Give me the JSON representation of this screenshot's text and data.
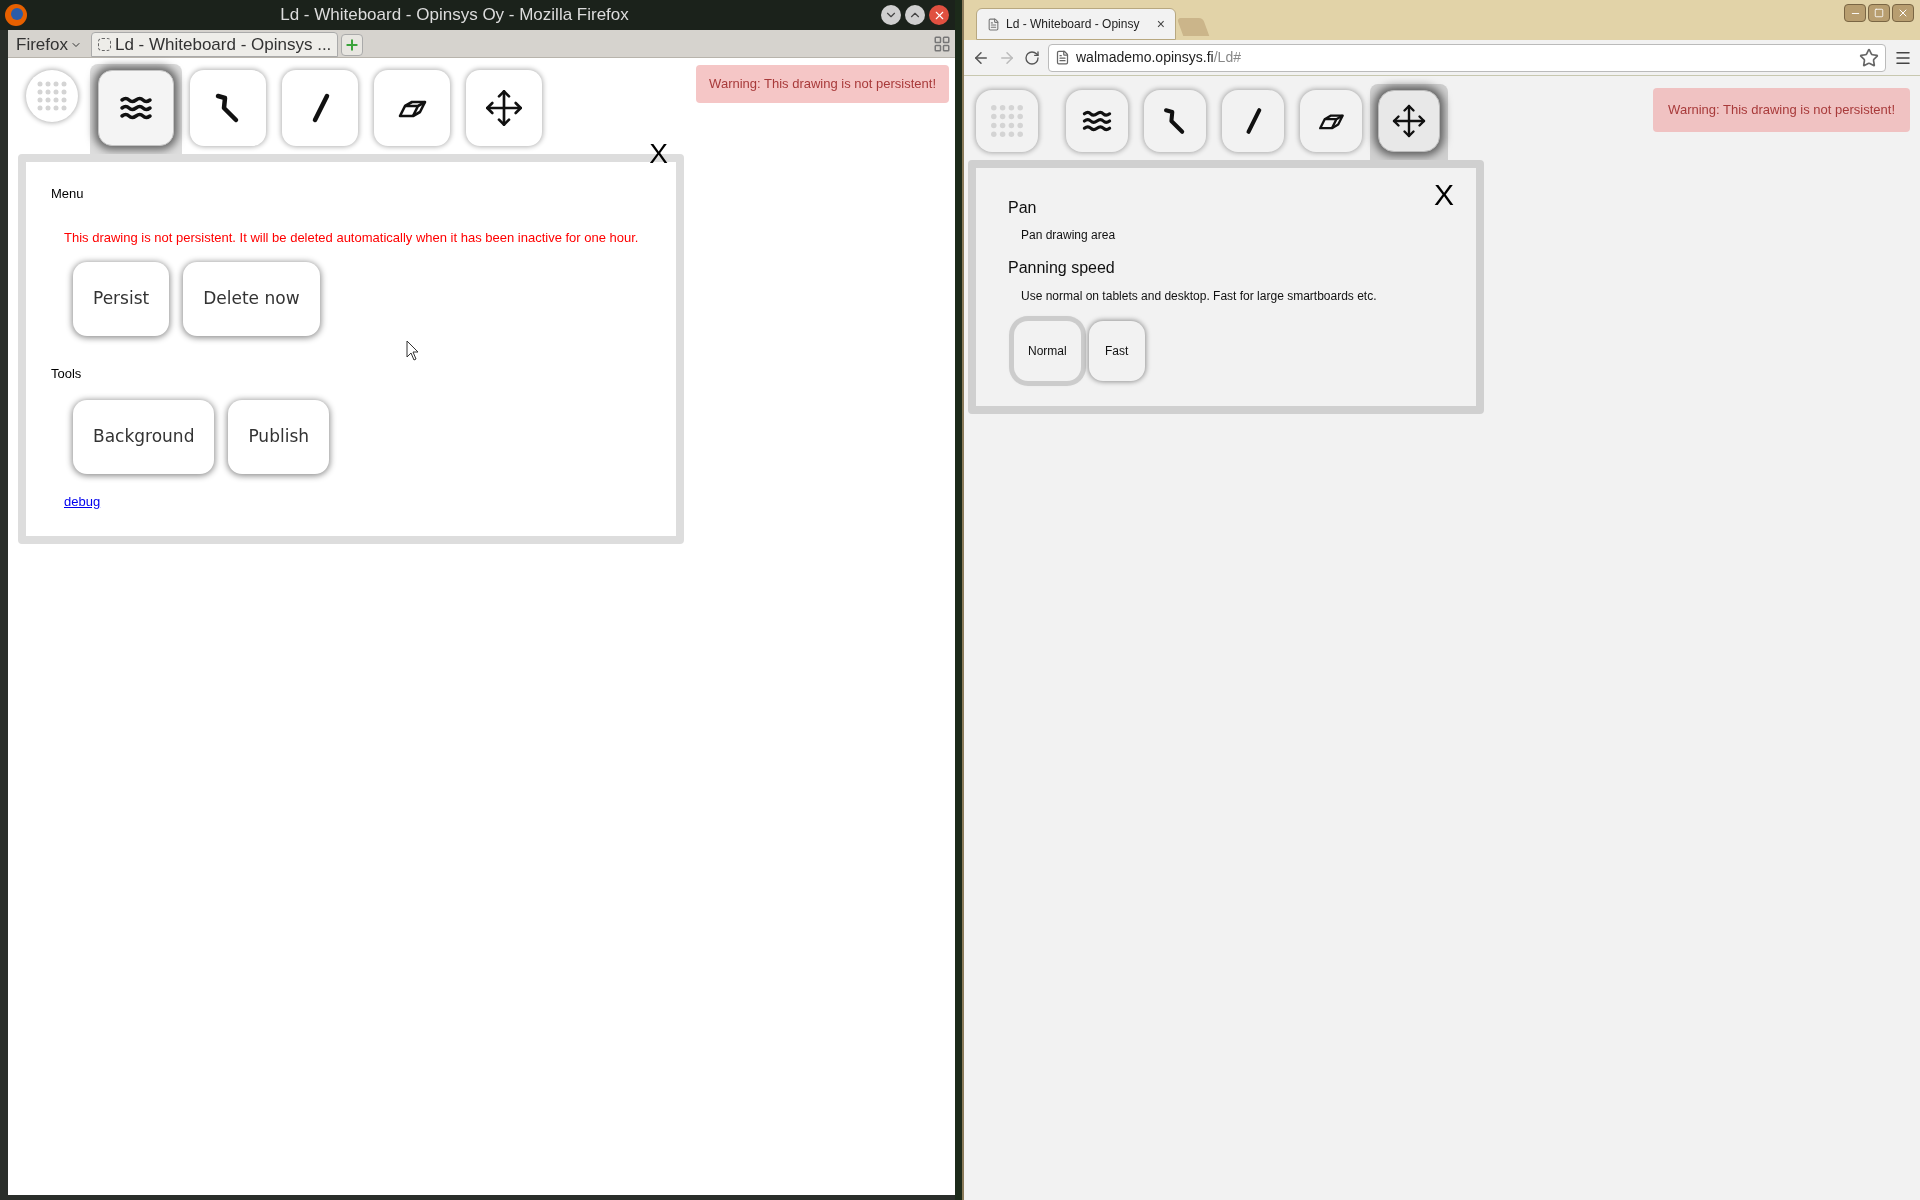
{
  "firefox": {
    "window_title": "Ld - Whiteboard - Opinsys Oy - Mozilla Firefox",
    "menu_button": "Firefox",
    "tabs": [
      {
        "title": "Ld - Whiteboard - Opinsys ...",
        "selected": true
      }
    ],
    "toolbar": [
      {
        "kind": "dots",
        "selected": false
      },
      {
        "kind": "menu",
        "selected": true
      },
      {
        "kind": "pen",
        "selected": false
      },
      {
        "kind": "line",
        "selected": false
      },
      {
        "kind": "eraser",
        "selected": false
      },
      {
        "kind": "pan",
        "selected": false
      }
    ],
    "warning": "Warning: This drawing is not persistent!",
    "panel": {
      "close": "X",
      "heading": "Menu",
      "notice": "This drawing is not persistent. It will be deleted automatically when it has been inactive for one hour.",
      "buttons": [
        "Persist",
        "Delete now"
      ],
      "tools_heading": "Tools",
      "tools": [
        "Background",
        "Publish"
      ],
      "link": "debug"
    }
  },
  "chrome": {
    "tabs": [
      {
        "title": "Ld - Whiteboard - Opinsy",
        "close": "×",
        "selected": true
      }
    ],
    "url_host": "walmademo.opinsys.fi",
    "url_path": "/Ld#",
    "toolbar": [
      {
        "kind": "dots",
        "selected": false
      },
      {
        "kind": "menu",
        "selected": false
      },
      {
        "kind": "pen",
        "selected": false
      },
      {
        "kind": "line",
        "selected": false
      },
      {
        "kind": "eraser",
        "selected": false
      },
      {
        "kind": "pan",
        "selected": true
      }
    ],
    "warning": "Warning: This drawing is not persistent!",
    "panel": {
      "close": "X",
      "title": "Pan",
      "description": "Pan drawing area",
      "speed_heading": "Panning speed",
      "speed_description": "Use normal on tablets and desktop. Fast for large smartboards etc.",
      "options": [
        {
          "label": "Normal",
          "selected": true
        },
        {
          "label": "Fast",
          "selected": false
        }
      ]
    }
  }
}
